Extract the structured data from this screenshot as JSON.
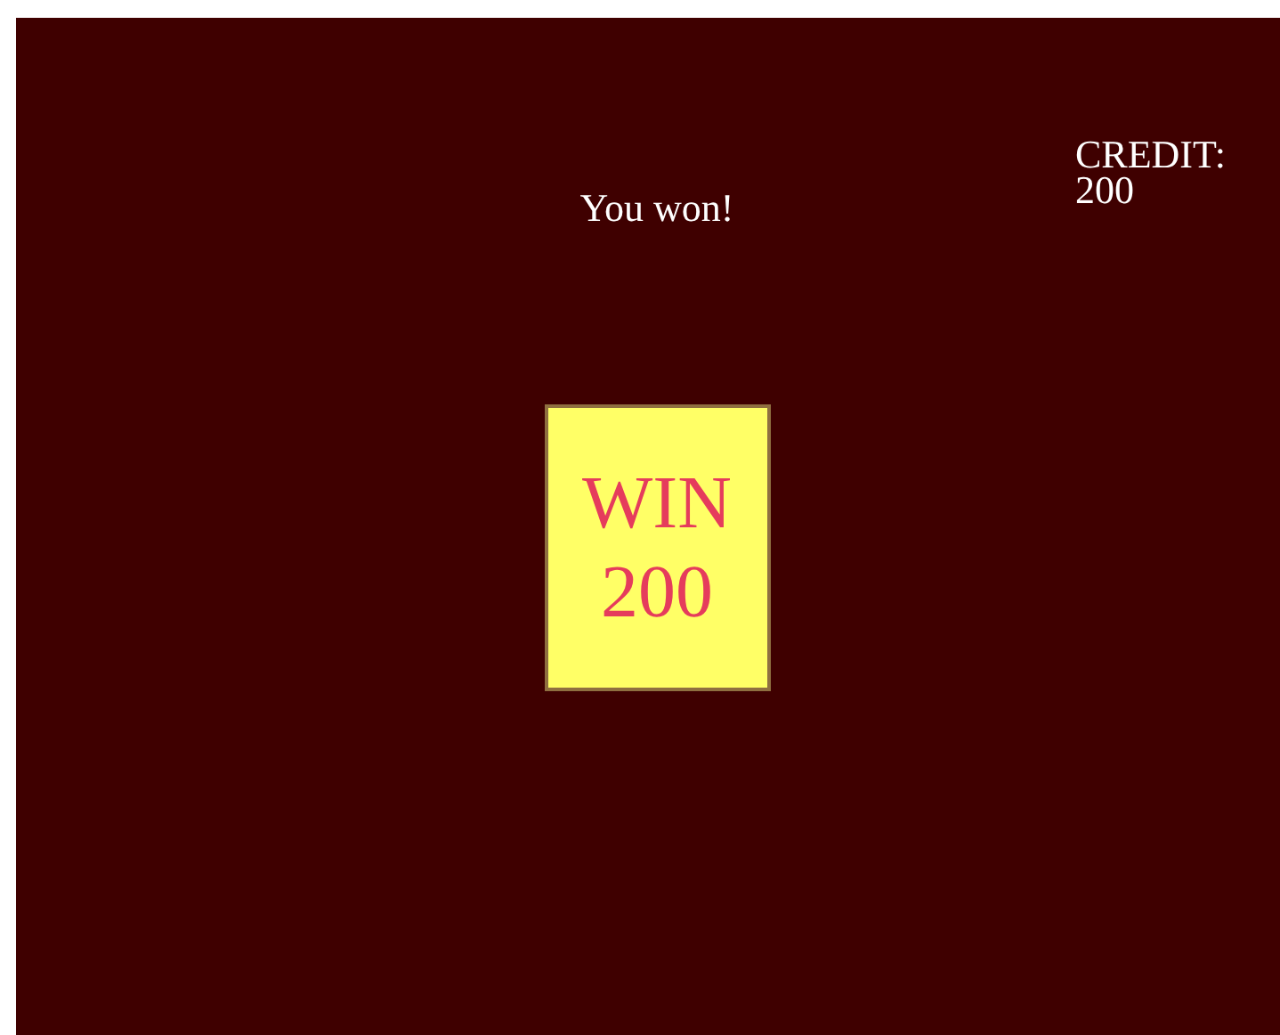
{
  "credit": {
    "label": "CREDIT:",
    "value": "200"
  },
  "message": "You won!",
  "win_card": {
    "label": "WIN",
    "amount": "200"
  }
}
